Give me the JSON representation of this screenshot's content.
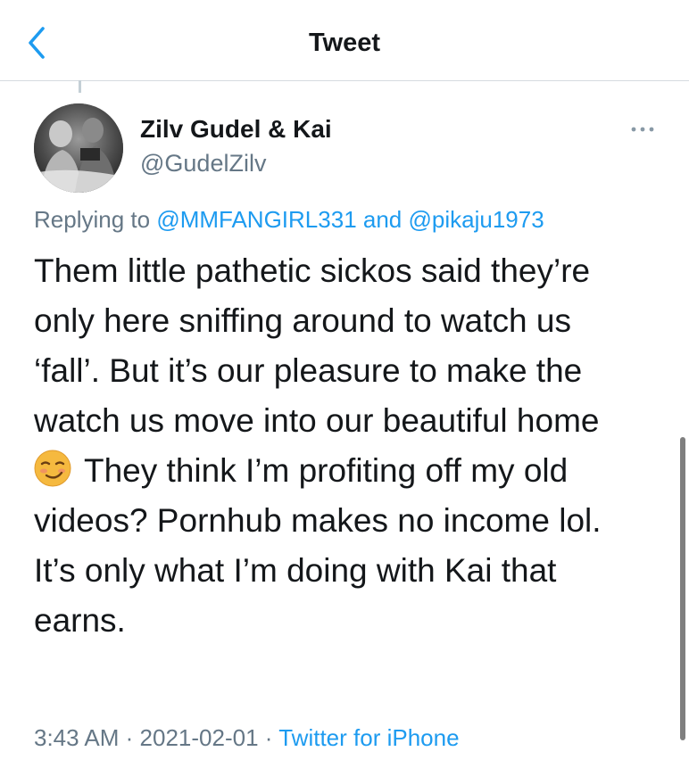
{
  "nav": {
    "title": "Tweet",
    "back_icon": "chevron-left-icon"
  },
  "author": {
    "name": "Zilv Gudel & Kai",
    "handle": "@GudelZilv",
    "avatar_icon": "avatar-photo"
  },
  "more_icon": "ellipsis-icon",
  "reply": {
    "prefix": "Replying to",
    "user1": "@MMFANGIRL331",
    "joiner": "and",
    "user2": "@pikaju1973"
  },
  "tweet": {
    "lines": [
      "Them little pathetic sickos said they’re",
      "only here sniffing around to watch us",
      "‘fall’. But it’s our pleasure to make the",
      "watch us move into our beautiful home",
      "They think I’m profiting off my old",
      "videos? Pornhub makes no income lol.",
      "It’s only what I’m doing with Kai that",
      "earns."
    ],
    "emoji_icon": "smirking-face-emoji"
  },
  "meta": {
    "time": "3:43 AM",
    "sep1": "·",
    "date": "2021-02-01",
    "sep2": "·",
    "source": "Twitter for iPhone"
  },
  "colors": {
    "link": "#1d9bf0",
    "secondary_text": "#657786",
    "primary_text": "#14171a"
  }
}
